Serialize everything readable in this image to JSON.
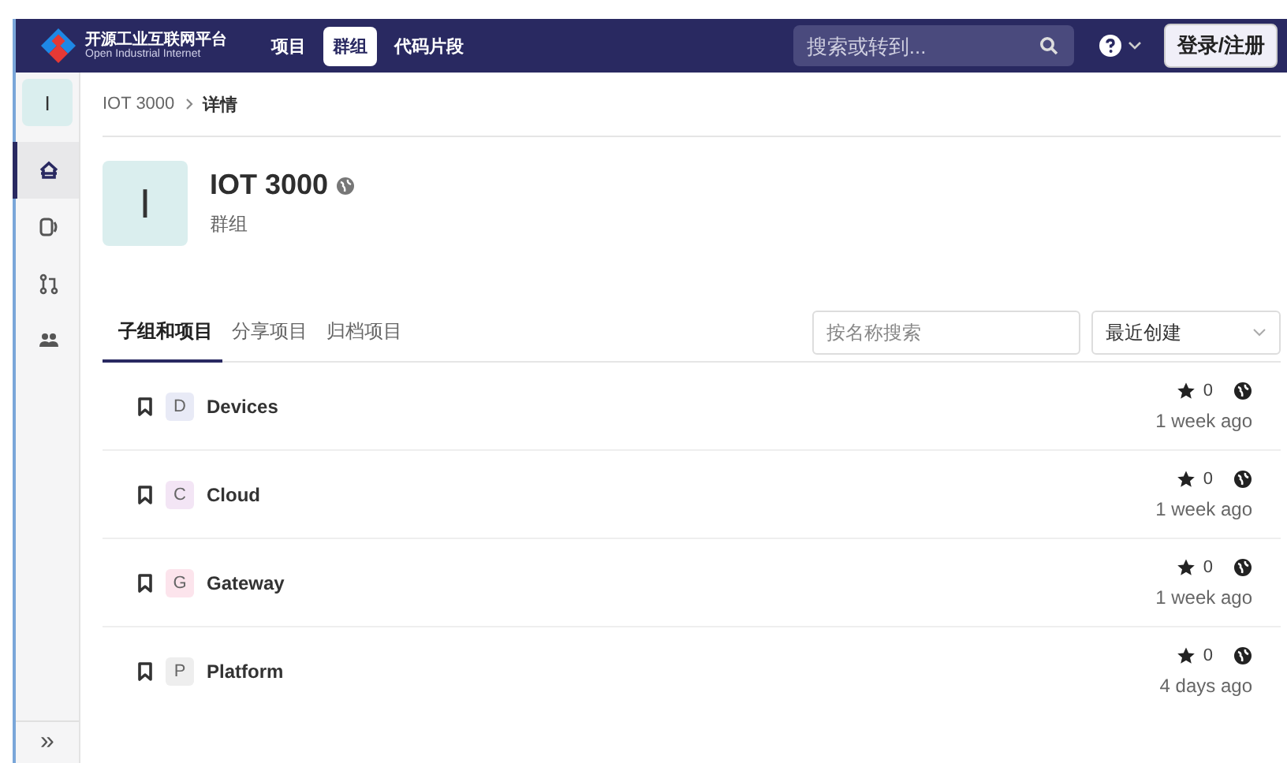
{
  "navbar": {
    "brand": {
      "title": "开源工业互联网平台",
      "subtitle": "Open Industrial Internet"
    },
    "nav_items": [
      {
        "label": "项目",
        "selected": false
      },
      {
        "label": "群组",
        "selected": true
      },
      {
        "label": "代码片段",
        "selected": false
      }
    ],
    "search": {
      "placeholder": "搜索或转到..."
    },
    "login_button": "登录/注册"
  },
  "sidebar": {
    "group_letter": "I",
    "items": [
      {
        "kind": "home",
        "selected": true
      },
      {
        "kind": "issues",
        "selected": false
      },
      {
        "kind": "merge",
        "selected": false
      },
      {
        "kind": "members",
        "selected": false
      }
    ],
    "collapse": "»"
  },
  "breadcrumb": [
    {
      "label": "IOT 3000",
      "current": false
    },
    {
      "label": "详情",
      "current": true
    }
  ],
  "group": {
    "avatar_letter": "I",
    "name": "IOT 3000",
    "type": "群组"
  },
  "tabs": [
    {
      "label": "子组和项目",
      "selected": true
    },
    {
      "label": "分享项目",
      "selected": false
    },
    {
      "label": "归档项目",
      "selected": false
    }
  ],
  "filter": {
    "placeholder": "按名称搜索",
    "sort": "最近创建"
  },
  "projects": [
    {
      "letter": "D",
      "name": "Devices",
      "color": "#e8eaf6",
      "stars": "0",
      "updated": "1 week ago"
    },
    {
      "letter": "C",
      "name": "Cloud",
      "color": "#f3e5f5",
      "stars": "0",
      "updated": "1 week ago"
    },
    {
      "letter": "G",
      "name": "Gateway",
      "color": "#fce4ec",
      "stars": "0",
      "updated": "1 week ago"
    },
    {
      "letter": "P",
      "name": "Platform",
      "color": "#eeeeee",
      "stars": "0",
      "updated": "4 days ago"
    }
  ]
}
